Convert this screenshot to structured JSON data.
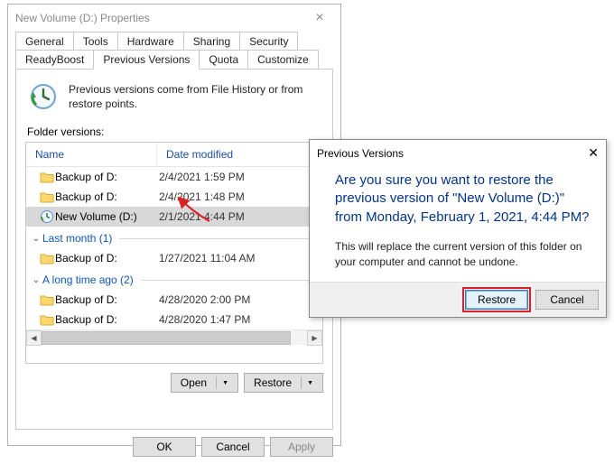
{
  "window": {
    "title": "New Volume (D:) Properties",
    "tabs_row1": [
      "General",
      "Tools",
      "Hardware",
      "Sharing",
      "Security"
    ],
    "tabs_row2": [
      "ReadyBoost",
      "Previous Versions",
      "Quota",
      "Customize"
    ],
    "active_tab": "Previous Versions",
    "explain": "Previous versions come from File History or from restore points.",
    "list_label": "Folder versions:",
    "columns": {
      "name": "Name",
      "date": "Date modified"
    },
    "rows": [
      {
        "type": "item",
        "icon": "folder",
        "name": "Backup of D:",
        "date": "2/4/2021 1:59 PM"
      },
      {
        "type": "item",
        "icon": "folder",
        "name": "Backup of D:",
        "date": "2/4/2021 1:48 PM"
      },
      {
        "type": "item",
        "icon": "drive",
        "name": "New Volume (D:)",
        "date": "2/1/2021 4:44 PM",
        "selected": true
      },
      {
        "type": "group",
        "label": "Last month (1)"
      },
      {
        "type": "item",
        "icon": "folder",
        "name": "Backup of D:",
        "date": "1/27/2021 11:04 AM"
      },
      {
        "type": "group",
        "label": "A long time ago (2)"
      },
      {
        "type": "item",
        "icon": "folder",
        "name": "Backup of D:",
        "date": "4/28/2020 2:00 PM"
      },
      {
        "type": "item",
        "icon": "folder",
        "name": "Backup of D:",
        "date": "4/28/2020 1:47 PM"
      }
    ],
    "buttons": {
      "open": "Open",
      "restore": "Restore"
    },
    "footer": {
      "ok": "OK",
      "cancel": "Cancel",
      "apply": "Apply"
    }
  },
  "dialog": {
    "title": "Previous Versions",
    "main": "Are you sure you want to restore the previous version of \"New Volume (D:)\" from Monday, February 1, 2021, 4:44 PM?",
    "sub": "This will replace the current version of this folder on your computer and cannot be undone.",
    "restore": "Restore",
    "cancel": "Cancel"
  }
}
